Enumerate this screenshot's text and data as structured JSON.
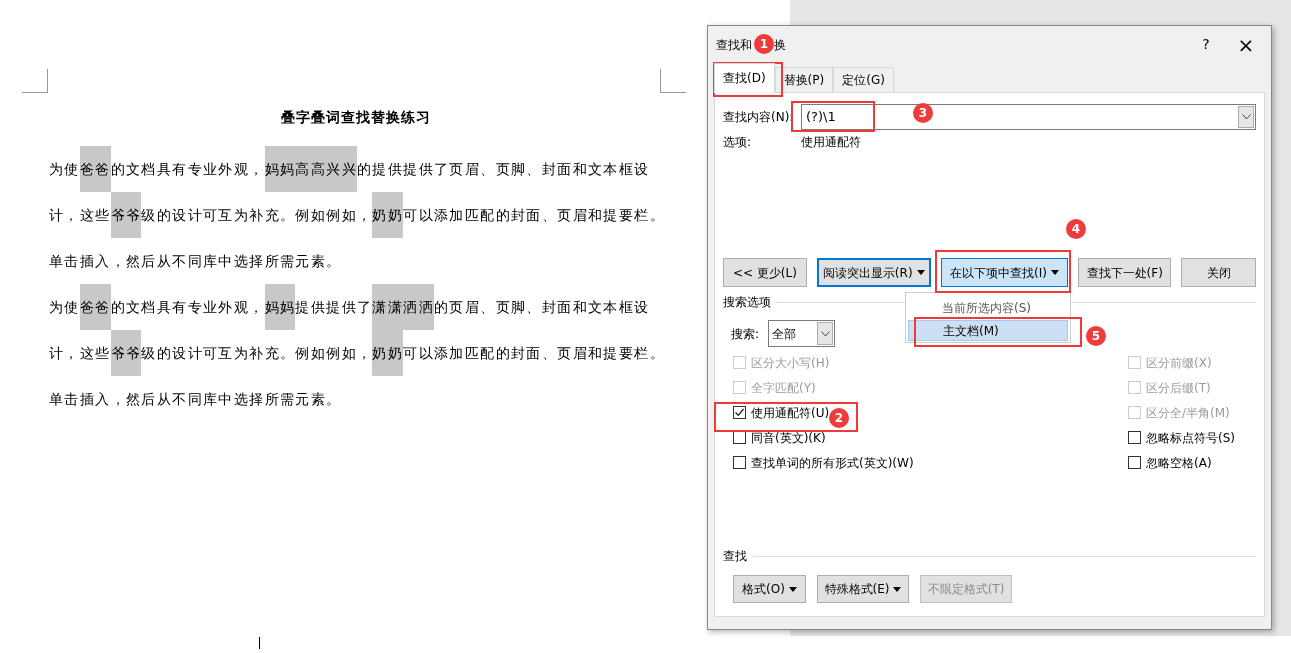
{
  "document": {
    "title": "叠字叠词查找替换练习",
    "lines": [
      [
        {
          "text": "为使",
          "highlighted": false
        },
        {
          "text": "爸爸",
          "highlighted": true
        },
        {
          "text": "的文档具有专业外观，",
          "highlighted": false
        },
        {
          "text": "妈妈高高兴兴",
          "highlighted": true
        },
        {
          "text": "的提供提供了页眉、页脚、封面和文本框设",
          "highlighted": false
        }
      ],
      [
        {
          "text": "计，这些",
          "highlighted": false
        },
        {
          "text": "爷爷",
          "highlighted": true
        },
        {
          "text": "级的设计可互为补充。例如例如，",
          "highlighted": false
        },
        {
          "text": "奶奶",
          "highlighted": true
        },
        {
          "text": "可以添加匹配的封面、页眉和提要栏。",
          "highlighted": false
        }
      ],
      [
        {
          "text": "单击插入，然后从不同库中选择所需元素。",
          "highlighted": false
        }
      ],
      [
        {
          "text": "为使",
          "highlighted": false
        },
        {
          "text": "爸爸",
          "highlighted": true
        },
        {
          "text": "的文档具有专业外观，",
          "highlighted": false
        },
        {
          "text": "妈妈",
          "highlighted": true
        },
        {
          "text": "提供提供了",
          "highlighted": false
        },
        {
          "text": "潇潇洒洒",
          "highlighted": true
        },
        {
          "text": "的页眉、页脚、封面和文本框设",
          "highlighted": false
        }
      ],
      [
        {
          "text": "计，这些",
          "highlighted": false
        },
        {
          "text": "爷爷",
          "highlighted": true
        },
        {
          "text": "级的设计可互为补充。例如例如，",
          "highlighted": false
        },
        {
          "text": "奶奶",
          "highlighted": true
        },
        {
          "text": "可以添加匹配的封面、页眉和提要栏。",
          "highlighted": false
        }
      ],
      [
        {
          "text": "单击插入，然后从不同库中选择所需元素。",
          "highlighted": false
        }
      ]
    ]
  },
  "dialog": {
    "title_parts": [
      "查找和",
      "换"
    ],
    "help": "?",
    "close": "×",
    "tabs": [
      {
        "label": "查找(D)",
        "selected": true
      },
      {
        "label": "替换(P)",
        "selected": false
      },
      {
        "label": "定位(G)",
        "selected": false
      }
    ],
    "find_label": "查找内容(N):",
    "find_value": "(?)\\1",
    "options_label": "选项:",
    "options_value": "使用通配符",
    "buttons": [
      {
        "label": "<< 更少(L)",
        "dropdown": false,
        "kind": "normal"
      },
      {
        "label": "阅读突出显示(R)",
        "dropdown": true,
        "kind": "focused"
      },
      {
        "label": "在以下项中查找(I)",
        "dropdown": true,
        "kind": "pressed"
      },
      {
        "label": "查找下一处(F)",
        "dropdown": false,
        "kind": "normal"
      },
      {
        "label": "关闭",
        "dropdown": false,
        "kind": "normal"
      }
    ],
    "menu": [
      {
        "label": "当前所选内容(S)",
        "selected": false
      },
      {
        "label": "主文档(M)",
        "selected": true
      }
    ],
    "search_options_heading": "搜索选项",
    "search_label": "搜索:",
    "search_value": "全部",
    "left_options": [
      {
        "label": "区分大小写(H)",
        "checked": false,
        "disabled": true
      },
      {
        "label": "全字匹配(Y)",
        "checked": false,
        "disabled": true
      },
      {
        "label": "使用通配符(U)",
        "checked": true,
        "disabled": false
      },
      {
        "label": "同音(英文)(K)",
        "checked": false,
        "disabled": false
      },
      {
        "label": "查找单词的所有形式(英文)(W)",
        "checked": false,
        "disabled": false
      }
    ],
    "right_options": [
      {
        "label": "区分前缀(X)",
        "checked": false,
        "disabled": true
      },
      {
        "label": "区分后缀(T)",
        "checked": false,
        "disabled": true
      },
      {
        "label": "区分全/半角(M)",
        "checked": false,
        "disabled": true
      },
      {
        "label": "忽略标点符号(S)",
        "checked": false,
        "disabled": false
      },
      {
        "label": "忽略空格(A)",
        "checked": false,
        "disabled": false
      }
    ],
    "find_heading": "查找",
    "format_buttons": [
      {
        "label": "格式(O)",
        "dropdown": true,
        "disabled": false
      },
      {
        "label": "特殊格式(E)",
        "dropdown": true,
        "disabled": false
      },
      {
        "label": "不限定格式(T)",
        "dropdown": false,
        "disabled": true
      }
    ]
  },
  "annotations": [
    {
      "number": "1"
    },
    {
      "number": "2"
    },
    {
      "number": "3"
    },
    {
      "number": "4"
    },
    {
      "number": "5"
    }
  ]
}
